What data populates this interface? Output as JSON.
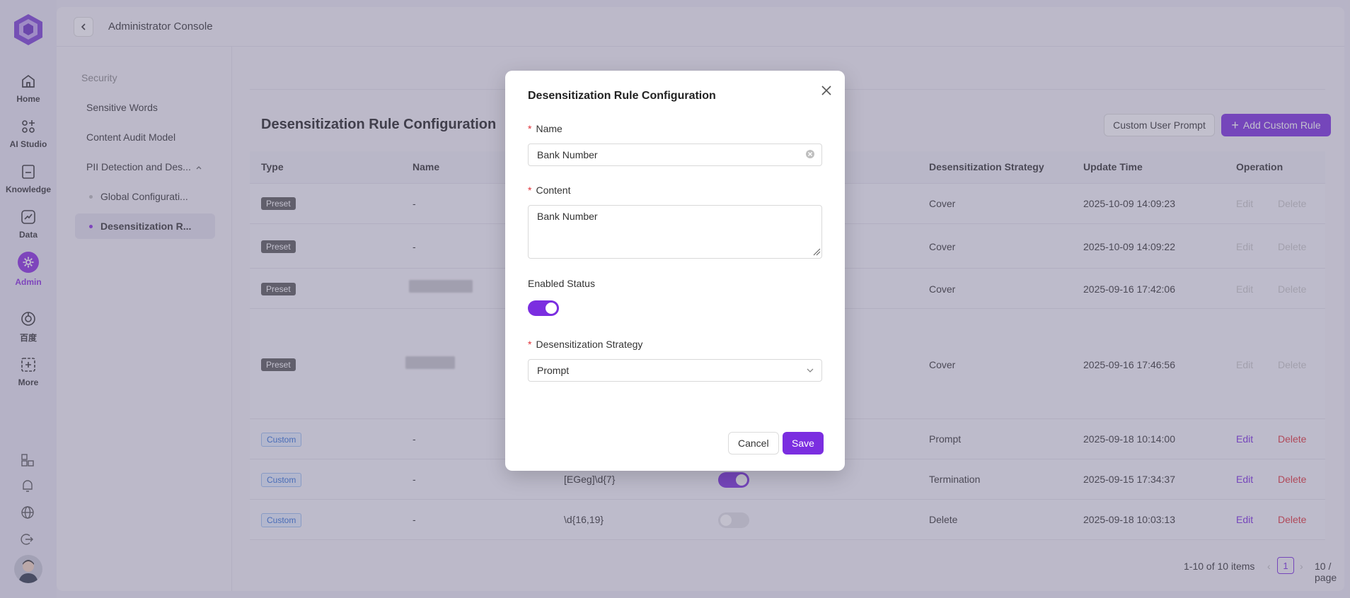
{
  "rail": {
    "items": [
      {
        "label": "Home",
        "icon": "home-icon"
      },
      {
        "label": "AI Studio",
        "icon": "ai-studio-icon"
      },
      {
        "label": "Knowledge",
        "icon": "knowledge-icon"
      },
      {
        "label": "Data",
        "icon": "data-icon"
      },
      {
        "label": "Admin",
        "icon": "gear-icon"
      },
      {
        "label": "百度",
        "icon": "baidu-icon"
      },
      {
        "label": "More",
        "icon": "more-icon"
      }
    ],
    "accent": "#8a2be2"
  },
  "header": {
    "title": "Administrator Console"
  },
  "subnav": {
    "section": "Security",
    "items": [
      "Sensitive Words",
      "Content Audit Model",
      "PII Detection and Des..."
    ],
    "children": [
      "Global Configurati...",
      "Desensitization R..."
    ]
  },
  "page": {
    "title": "Desensitization Rule Configuration",
    "custom_prompt_btn": "Custom User Prompt",
    "add_rule_btn": "Add Custom Rule",
    "columns": [
      "Type",
      "Name",
      "Desensitization Strategy",
      "Update Time",
      "Operation"
    ],
    "rows": [
      {
        "type": "Preset",
        "name": "-",
        "rule": "",
        "enabled": null,
        "strategy": "Cover",
        "time": "2025-10-09 14:09:23",
        "edit": "Edit",
        "del": "Delete"
      },
      {
        "type": "Preset",
        "name": "-",
        "rule": "",
        "enabled": null,
        "strategy": "Cover",
        "time": "2025-10-09 14:09:22",
        "edit": "Edit",
        "del": "Delete"
      },
      {
        "type": "Preset",
        "name": "",
        "rule": "",
        "enabled": null,
        "strategy": "Cover",
        "time": "2025-09-16 17:42:06",
        "edit": "Edit",
        "del": "Delete"
      },
      {
        "type": "Preset",
        "name": "",
        "rule": "",
        "enabled": null,
        "strategy": "Cover",
        "time": "2025-09-16 17:46:56",
        "edit": "Edit",
        "del": "Delete"
      },
      {
        "type": "Custom",
        "name": "-",
        "rule": "",
        "enabled": null,
        "strategy": "Prompt",
        "time": "2025-09-18 10:14:00",
        "edit": "Edit",
        "del": "Delete"
      },
      {
        "type": "Custom",
        "name": "-",
        "rule": "[EGeg]\\d{7}",
        "enabled": true,
        "strategy": "Termination",
        "time": "2025-09-15 17:34:37",
        "edit": "Edit",
        "del": "Delete"
      },
      {
        "type": "Custom",
        "name": "-",
        "rule": "\\d{16,19}",
        "enabled": false,
        "strategy": "Delete",
        "time": "2025-09-18 10:03:13",
        "edit": "Edit",
        "del": "Delete"
      }
    ],
    "pagination": {
      "summary": "1-10 of 10 items",
      "current": "1",
      "page_size": "10 / page"
    }
  },
  "modal": {
    "title": "Desensitization Rule Configuration",
    "name_label": "Name",
    "name_value": "Bank Number",
    "content_label": "Content",
    "content_value": "Bank Number",
    "status_label": "Enabled Status",
    "enabled": true,
    "strategy_label": "Desensitization Strategy",
    "strategy_value": "Prompt",
    "cancel": "Cancel",
    "save": "Save"
  }
}
